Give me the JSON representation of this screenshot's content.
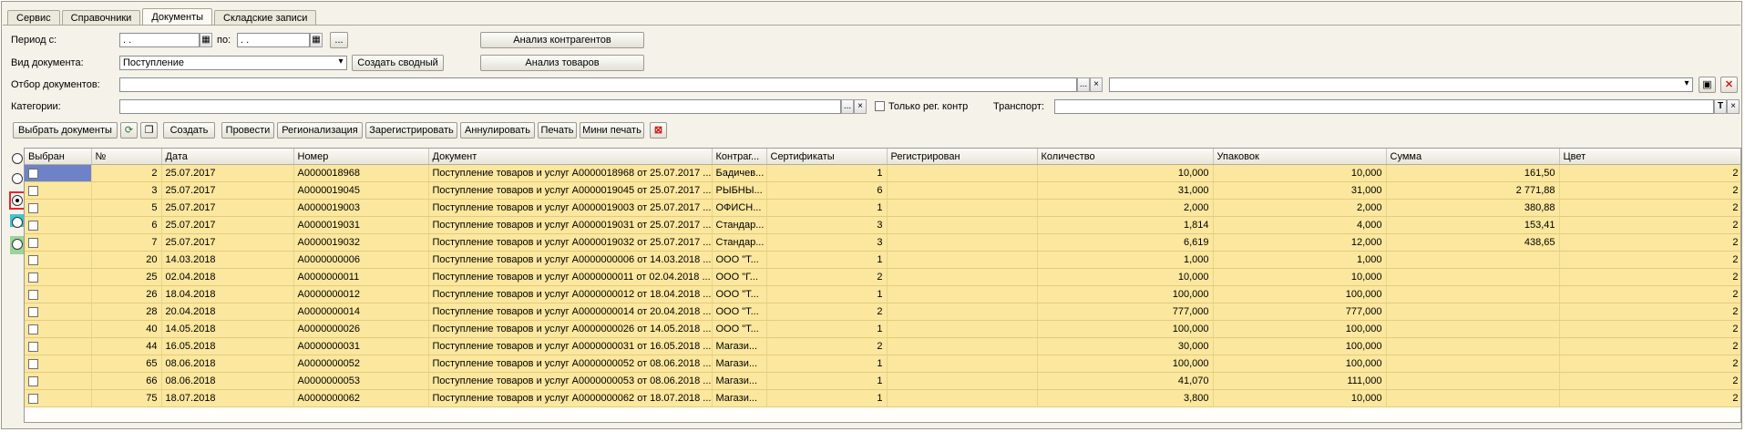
{
  "tabs": [
    "Сервис",
    "Справочники",
    "Документы",
    "Складские записи"
  ],
  "form": {
    "period_label": "Период с:",
    "period_from": " .  .",
    "period_to_label": "по:",
    "period_to": " .  .",
    "doc_type_label": "Вид документа:",
    "doc_type_value": "Поступление",
    "create_summary": "Создать сводный",
    "filter_label": "Отбор документов:",
    "category_label": "Категории:",
    "only_reg_label": "Только рег. контр",
    "transport_label": "Транспорт:",
    "analysis_contractors": "Анализ контрагентов",
    "analysis_goods": "Анализ товаров",
    "ellipsis": "...",
    "clear": "×",
    "t_btn": "T"
  },
  "toolbar": {
    "select_docs": "Выбрать документы",
    "create": "Создать",
    "post": "Провести",
    "regionalize": "Регионализация",
    "register": "Зарегистрировать",
    "annul": "Аннулировать",
    "print": "Печать",
    "mini_print": "Мини печать"
  },
  "columns": [
    "Выбран",
    "№",
    "Дата",
    "Номер",
    "Документ",
    "Контраг...",
    "Сертификаты",
    "Регистрирован",
    "Количество",
    "Упаковок",
    "Сумма",
    "Цвет"
  ],
  "rows": [
    {
      "n": "2",
      "date": "25.07.2017",
      "num": "А0000018968",
      "doc": "Поступление товаров и услуг А0000018968 от 25.07.2017 ...",
      "contr": "Бадичев...",
      "cert": "1",
      "reg": "",
      "qty": "10,000",
      "pack": "10,000",
      "sum": "161,50",
      "color": "2"
    },
    {
      "n": "3",
      "date": "25.07.2017",
      "num": "А0000019045",
      "doc": "Поступление товаров и услуг А0000019045 от 25.07.2017 ...",
      "contr": "РЫБНЫ...",
      "cert": "6",
      "reg": "",
      "qty": "31,000",
      "pack": "31,000",
      "sum": "2 771,88",
      "color": "2"
    },
    {
      "n": "5",
      "date": "25.07.2017",
      "num": "А0000019003",
      "doc": "Поступление товаров и услуг А0000019003 от 25.07.2017 ...",
      "contr": "ОФИСН...",
      "cert": "1",
      "reg": "",
      "qty": "2,000",
      "pack": "2,000",
      "sum": "380,88",
      "color": "2"
    },
    {
      "n": "6",
      "date": "25.07.2017",
      "num": "А0000019031",
      "doc": "Поступление товаров и услуг А0000019031 от 25.07.2017 ...",
      "contr": "Стандар...",
      "cert": "3",
      "reg": "",
      "qty": "1,814",
      "pack": "4,000",
      "sum": "153,41",
      "color": "2"
    },
    {
      "n": "7",
      "date": "25.07.2017",
      "num": "А0000019032",
      "doc": "Поступление товаров и услуг А0000019032 от 25.07.2017 ...",
      "contr": "Стандар...",
      "cert": "3",
      "reg": "",
      "qty": "6,619",
      "pack": "12,000",
      "sum": "438,65",
      "color": "2"
    },
    {
      "n": "20",
      "date": "14.03.2018",
      "num": "А0000000006",
      "doc": "Поступление товаров и услуг А0000000006 от 14.03.2018 ...",
      "contr": "ООО \"Т...",
      "cert": "1",
      "reg": "",
      "qty": "1,000",
      "pack": "1,000",
      "sum": "",
      "color": "2"
    },
    {
      "n": "25",
      "date": "02.04.2018",
      "num": "А0000000011",
      "doc": "Поступление товаров и услуг А0000000011 от 02.04.2018 ...",
      "contr": "ООО \"Г...",
      "cert": "2",
      "reg": "",
      "qty": "10,000",
      "pack": "10,000",
      "sum": "",
      "color": "2"
    },
    {
      "n": "26",
      "date": "18.04.2018",
      "num": "А0000000012",
      "doc": "Поступление товаров и услуг А0000000012 от 18.04.2018 ...",
      "contr": "ООО \"Т...",
      "cert": "1",
      "reg": "",
      "qty": "100,000",
      "pack": "100,000",
      "sum": "",
      "color": "2"
    },
    {
      "n": "28",
      "date": "20.04.2018",
      "num": "А0000000014",
      "doc": "Поступление товаров и услуг А0000000014 от 20.04.2018 ...",
      "contr": "ООО \"Т...",
      "cert": "2",
      "reg": "",
      "qty": "777,000",
      "pack": "777,000",
      "sum": "",
      "color": "2"
    },
    {
      "n": "40",
      "date": "14.05.2018",
      "num": "А0000000026",
      "doc": "Поступление товаров и услуг А0000000026 от 14.05.2018 ...",
      "contr": "ООО \"Т...",
      "cert": "1",
      "reg": "",
      "qty": "100,000",
      "pack": "100,000",
      "sum": "",
      "color": "2"
    },
    {
      "n": "44",
      "date": "16.05.2018",
      "num": "А0000000031",
      "doc": "Поступление товаров и услуг А0000000031 от 16.05.2018 ...",
      "contr": "Магази...",
      "cert": "2",
      "reg": "",
      "qty": "30,000",
      "pack": "100,000",
      "sum": "",
      "color": "2"
    },
    {
      "n": "65",
      "date": "08.06.2018",
      "num": "А0000000052",
      "doc": "Поступление товаров и услуг А0000000052 от 08.06.2018 ...",
      "contr": "Магази...",
      "cert": "1",
      "reg": "",
      "qty": "100,000",
      "pack": "100,000",
      "sum": "",
      "color": "2"
    },
    {
      "n": "66",
      "date": "08.06.2018",
      "num": "А0000000053",
      "doc": "Поступление товаров и услуг А0000000053 от 08.06.2018 ...",
      "contr": "Магази...",
      "cert": "1",
      "reg": "",
      "qty": "41,070",
      "pack": "111,000",
      "sum": "",
      "color": "2"
    },
    {
      "n": "75",
      "date": "18.07.2018",
      "num": "А0000000062",
      "doc": "Поступление товаров и услуг А0000000062 от 18.07.2018 ...",
      "contr": "Магази...",
      "cert": "1",
      "reg": "",
      "qty": "3,800",
      "pack": "10,000",
      "sum": "",
      "color": "2"
    }
  ],
  "colors": {
    "row": "#fbe79d",
    "selected": "#6d82c8",
    "arrow": "#e8262b",
    "strip_cyan": "#3cc7d0",
    "strip_green": "#9bd49a"
  }
}
